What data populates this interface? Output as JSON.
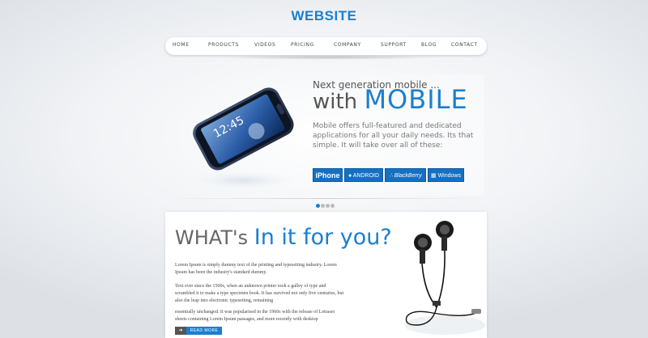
{
  "header": {
    "logo": "WEBSITE"
  },
  "nav": {
    "items": [
      "HOME",
      "PRODUCTS",
      "VIDEOS",
      "PRICING",
      "COMPANY",
      "SUPPORT",
      "BLOG",
      "CONTACT"
    ]
  },
  "hero": {
    "kicker": "Next generation mobile ...",
    "title_pre": "with ",
    "title_big": "MOBILE",
    "description": "Mobile offers full-featured and dedicated applications for all your daily needs. Its that simple. It will take over all of these:",
    "phone_time": "12:45",
    "platforms": [
      "iPhone",
      "ANDROID",
      "BlackBerry",
      "Windows"
    ],
    "slider_dots": 4,
    "active_dot": 0
  },
  "card": {
    "heading_pre": "WHAT's ",
    "heading_big": "In it for you?",
    "paragraphs": [
      "Lorem Ipsum is simply dummy text of the printing and typesetting industry. Lorem Ipsum has been the industry's standard dummy.",
      "Text ever since the 1500s, when an unknown printer took a galley of type and scrambled it to make a type specimen book. It has survived not only five centuries, but also the leap into electronic typesetting, remaining",
      "essentially unchanged. It was popularised in the 1960s with the release of Letraset sheets containing Lorem Ipsum passages, and more recently with desktop"
    ],
    "read_more": "READ MORE"
  },
  "colors": {
    "accent": "#1a7fd0",
    "platform_bg": "#1570c2"
  }
}
